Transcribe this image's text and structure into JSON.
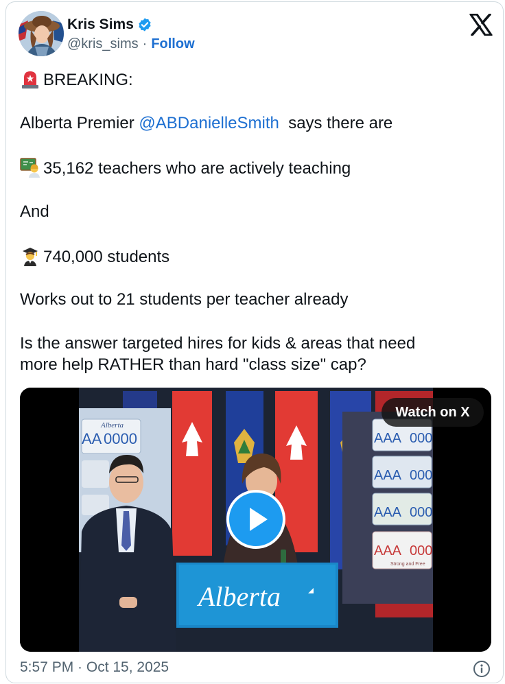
{
  "author": {
    "name": "Kris Sims",
    "handle": "@kris_sims",
    "separator": "·",
    "follow_label": "Follow"
  },
  "tweet": {
    "line1": "BREAKING:",
    "line2_prefix": "Alberta Premier",
    "mention": "@ABDanielleSmith",
    "line2_suffix": "says there are",
    "line3": "35,162 teachers who are actively teaching",
    "line4": "And",
    "line5": "740,000 students",
    "line6": "Works out to 21 students per teacher already",
    "line7": "Is the answer targeted hires for kids & areas that need",
    "line8": "more help RATHER than hard \"class size\" cap?"
  },
  "video": {
    "watch_label": "Watch on X",
    "podium_text": "Alberta",
    "plate_text": "AAA",
    "plate_number": "0000",
    "plate_tag": "Strong and Free"
  },
  "footer": {
    "timestamp": "5:57 PM · Oct 15, 2025"
  },
  "icons": {
    "verified": "verified-badge-icon",
    "x_logo": "x-logo-icon",
    "siren": "siren-emoji",
    "teacher": "teacher-emoji",
    "student": "student-emoji",
    "play": "play-icon",
    "info": "info-icon"
  },
  "colors": {
    "link": "#1d6fd1",
    "verified": "#1d9bf0",
    "play": "#1d9bf0",
    "muted": "#536471"
  }
}
